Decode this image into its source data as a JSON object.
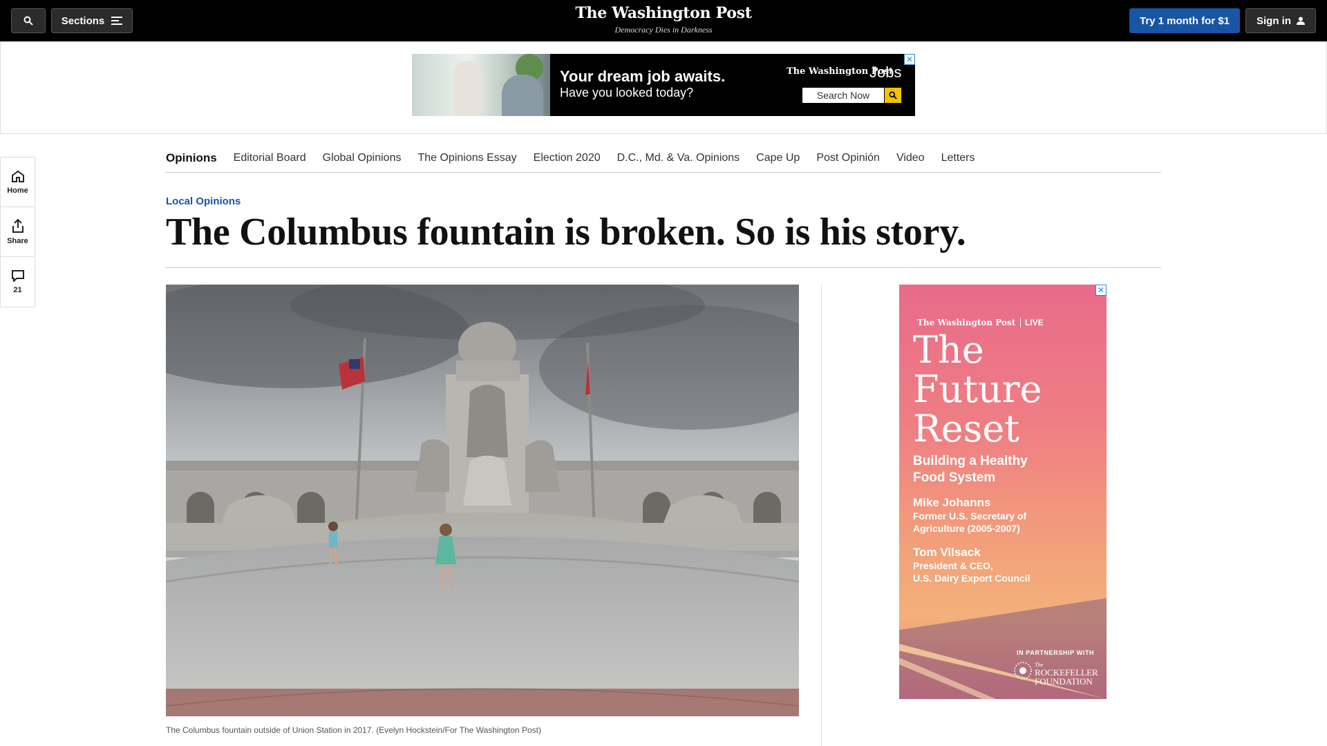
{
  "topbar": {
    "sections_label": "Sections",
    "brand_name": "The Washington Post",
    "brand_tagline": "Democracy Dies in Darkness",
    "try_label": "Try 1 month for $1",
    "signin_label": "Sign in"
  },
  "top_ad": {
    "headline": "Your dream job awaits.",
    "subhead": "Have you looked today?",
    "brand": "The Washington Post",
    "product": "Jobs",
    "search_label": "Search Now"
  },
  "rail": {
    "home_label": "Home",
    "share_label": "Share",
    "comments_count": "21"
  },
  "nav": {
    "items": [
      "Opinions",
      "Editorial Board",
      "Global Opinions",
      "The Opinions Essay",
      "Election 2020",
      "D.C., Md. & Va. Opinions",
      "Cape Up",
      "Post Opinión",
      "Video",
      "Letters"
    ]
  },
  "article": {
    "kicker": "Local Opinions",
    "headline": "The Columbus fountain is broken. So is his story.",
    "caption": "The Columbus fountain outside of Union Station in 2017. (Evelyn Hockstein/For The Washington Post)"
  },
  "side_ad": {
    "brand": "The Washington Post",
    "live": "LIVE",
    "title_lines": [
      "The",
      "Future",
      "Reset"
    ],
    "subtitle_lines": [
      "Building a Healthy",
      "Food System"
    ],
    "speaker1_name": "Mike Johanns",
    "speaker1_title_lines": [
      "Former U.S. Secretary of",
      "Agriculture (2005-2007)"
    ],
    "speaker2_name": "Tom Vilsack",
    "speaker2_title_lines": [
      "President & CEO,",
      "U.S. Dairy Export Council"
    ],
    "partner_label": "IN PARTNERSHIP WITH",
    "partner_name_lines": [
      "The",
      "ROCKEFELLER",
      "FOUNDATION"
    ]
  },
  "colors": {
    "accent_blue": "#1955a5",
    "topbar_bg": "#000000",
    "ad_close": "#2d8cd0"
  }
}
